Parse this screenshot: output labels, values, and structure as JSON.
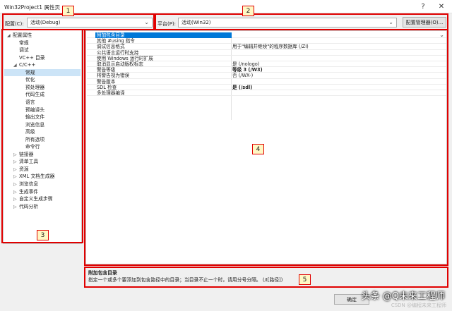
{
  "window": {
    "title": "Win32Project1 属性页",
    "help_glyph": "?",
    "close_glyph": "✕"
  },
  "toolbar": {
    "config_label": "配置(C):",
    "config_value": "活动(Debug)",
    "platform_label": "平台(P):",
    "platform_value": "活动(Win32)",
    "config_manager_label": "配置管理器(O)..."
  },
  "annotations": [
    "1",
    "2",
    "3",
    "4",
    "5"
  ],
  "tree": {
    "items": [
      {
        "label": "配置属性",
        "expander": "◢",
        "level": 0
      },
      {
        "label": "常规",
        "expander": "",
        "level": 1
      },
      {
        "label": "调试",
        "expander": "",
        "level": 1
      },
      {
        "label": "VC++ 目录",
        "expander": "",
        "level": 1
      },
      {
        "label": "C/C++",
        "expander": "◢",
        "level": 1
      },
      {
        "label": "常规",
        "expander": "",
        "level": 2,
        "selected": true
      },
      {
        "label": "优化",
        "expander": "",
        "level": 2
      },
      {
        "label": "预处理器",
        "expander": "",
        "level": 2
      },
      {
        "label": "代码生成",
        "expander": "",
        "level": 2
      },
      {
        "label": "语言",
        "expander": "",
        "level": 2
      },
      {
        "label": "预编译头",
        "expander": "",
        "level": 2
      },
      {
        "label": "输出文件",
        "expander": "",
        "level": 2
      },
      {
        "label": "浏览信息",
        "expander": "",
        "level": 2
      },
      {
        "label": "高级",
        "expander": "",
        "level": 2
      },
      {
        "label": "所有选项",
        "expander": "",
        "level": 2
      },
      {
        "label": "命令行",
        "expander": "",
        "level": 2
      },
      {
        "label": "链接器",
        "expander": "▷",
        "level": 1
      },
      {
        "label": "清单工具",
        "expander": "▷",
        "level": 1
      },
      {
        "label": "资源",
        "expander": "▷",
        "level": 1
      },
      {
        "label": "XML 文档生成器",
        "expander": "▷",
        "level": 1
      },
      {
        "label": "浏览信息",
        "expander": "▷",
        "level": 1
      },
      {
        "label": "生成事件",
        "expander": "▷",
        "level": 1
      },
      {
        "label": "自定义生成步骤",
        "expander": "▷",
        "level": 1
      },
      {
        "label": "代码分析",
        "expander": "▷",
        "level": 1
      }
    ]
  },
  "properties": {
    "rows": [
      {
        "name": "附加包含目录",
        "value": "",
        "selected": true,
        "bold": false
      },
      {
        "name": "其他 #using 指令",
        "value": "",
        "bold": false
      },
      {
        "name": "调试信息格式",
        "value": "用于\"编辑并继续\"的程序数据库 (/ZI)",
        "bold": false
      },
      {
        "name": "公共语言运行时支持",
        "value": "",
        "bold": false
      },
      {
        "name": "使用 Windows 运行时扩展",
        "value": "",
        "bold": false
      },
      {
        "name": "取消显示启动版权标志",
        "value": "是 (/nologo)",
        "bold": false
      },
      {
        "name": "警告等级",
        "value": "等级 3 (/W3)",
        "bold": true
      },
      {
        "name": "将警告视为错误",
        "value": "否 (/WX-)",
        "bold": false
      },
      {
        "name": "警告版本",
        "value": "",
        "bold": false
      },
      {
        "name": "SDL 检查",
        "value": "是 (/sdl)",
        "bold": true
      },
      {
        "name": "多处理器编译",
        "value": "",
        "bold": false
      }
    ]
  },
  "description": {
    "title": "附加包含目录",
    "text": "指定一个或多个要添加到包含路径中的目录；当目录不止一个时，请用分号分隔。     (/I[路径])"
  },
  "footer": {
    "ok_label": "确定",
    "watermark": "头条 @Q未来工程师",
    "watermark_sub": "CSDN @编程未来工程师"
  }
}
